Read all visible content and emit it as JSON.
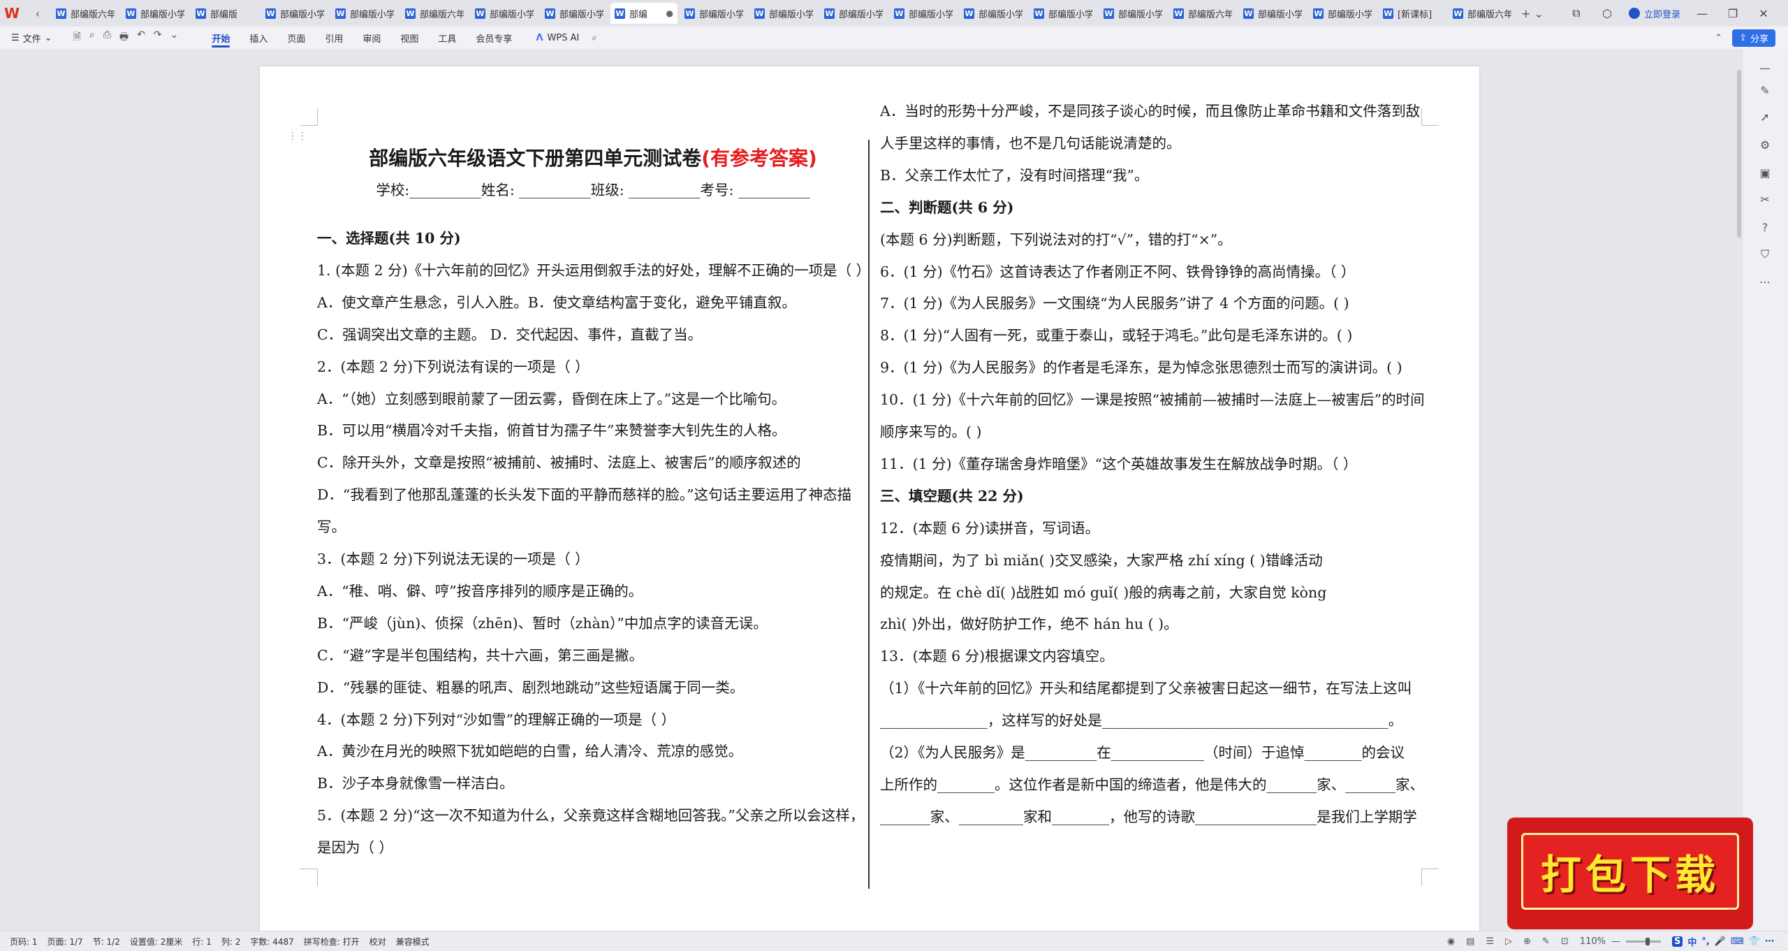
{
  "tabbar": {
    "logo": "W",
    "nav": "‹",
    "tabs": [
      {
        "label": "部编版六年",
        "active": false
      },
      {
        "label": "部编版小学",
        "active": false
      },
      {
        "label": "部编版",
        "active": false
      },
      {
        "label": "部编版小学",
        "active": false
      },
      {
        "label": "部编版小学",
        "active": false
      },
      {
        "label": "部编版六年",
        "active": false
      },
      {
        "label": "部编版小学",
        "active": false
      },
      {
        "label": "部编版小学",
        "active": false
      },
      {
        "label": "部编",
        "active": true
      },
      {
        "label": "部编版小学",
        "active": false
      },
      {
        "label": "部编版小学",
        "active": false
      },
      {
        "label": "部编版小学",
        "active": false
      },
      {
        "label": "部编版小学",
        "active": false
      },
      {
        "label": "部编版小学",
        "active": false
      },
      {
        "label": "部编版小学",
        "active": false
      },
      {
        "label": "部编版小学",
        "active": false
      },
      {
        "label": "部编版六年",
        "active": false
      },
      {
        "label": "部编版小学",
        "active": false
      },
      {
        "label": "部编版小学",
        "active": false
      },
      {
        "label": "[新课标]",
        "active": false
      },
      {
        "label": "部编版六年",
        "active": false
      }
    ],
    "login": "立即登录"
  },
  "ribbon": {
    "file": "文件",
    "tabs": [
      "开始",
      "插入",
      "页面",
      "引用",
      "审阅",
      "视图",
      "工具",
      "会员专享"
    ],
    "active_tab": "开始",
    "ai": "WPS AI",
    "share": "分享"
  },
  "doc": {
    "title_main": "部编版六年级语文下册第四单元测试卷",
    "title_red": "(有参考答案)",
    "info": "学校:__________姓名: __________班级: __________考号: __________",
    "left_lines": [
      {
        "text": "一、选择题(共 10 分)",
        "bold": true
      },
      {
        "text": "1. (本题 2 分)《十六年前的回忆》开头运用倒叙手法的好处，理解不正确的一项是（    ）"
      },
      {
        "text": "A．使文章产生悬念，引人入胜。B．使文章结构富于变化，避免平铺直叙。"
      },
      {
        "text": "C．强调突出文章的主题。           D．交代起因、事件，直截了当。"
      },
      {
        "text": "2．(本题 2 分)下列说法有误的一项是（    ）"
      },
      {
        "text": "A．“（她）立刻感到眼前蒙了一团云雾，昏倒在床上了。”这是一个比喻句。"
      },
      {
        "text": "B．可以用“横眉冷对千夫指，俯首甘为孺子牛”来赞誉李大钊先生的人格。"
      },
      {
        "text": "C．除开头外，文章是按照“被捕前、被捕时、法庭上、被害后”的顺序叙述的"
      },
      {
        "text": "D．“我看到了他那乱蓬蓬的长头发下面的平静而慈祥的脸。”这句话主要运用了神态描"
      },
      {
        "text": "写。"
      },
      {
        "text": "3．(本题 2 分)下列说法无误的一项是（    ）"
      },
      {
        "text": "A．“稚、哨、僻、哼”按音序排列的顺序是正确的。"
      },
      {
        "text": "B．“严峻（jùn)、侦探（zhēn)、暂时（zhàn）”中加点字的读音无误。"
      },
      {
        "text": "C．“避”字是半包围结构，共十六画，第三画是撇。"
      },
      {
        "text": "D．“残暴的匪徒、粗暴的吼声、剧烈地跳动”这些短语属于同一类。"
      },
      {
        "text": "4．(本题 2 分)下列对“沙如雪”的理解正确的一项是（   ）"
      },
      {
        "text": "A．黄沙在月光的映照下犹如皑皑的白雪，给人清冷、荒凉的感觉。"
      },
      {
        "text": "B．沙子本身就像雪一样洁白。"
      },
      {
        "text": "5．(本题 2 分)“这一次不知道为什么，父亲竟这样含糊地回答我。”父亲之所以会这样，"
      },
      {
        "text": "是因为（      ）"
      }
    ],
    "right_lines": [
      {
        "text": "A．当时的形势十分严峻，不是同孩子谈心的时候，而且像防止革命书籍和文件落到敌"
      },
      {
        "text": "人手里这样的事情，也不是几句话能说清楚的。"
      },
      {
        "text": "B．父亲工作太忙了，没有时间搭理“我”。"
      },
      {
        "text": "二、判断题(共 6 分)",
        "bold": true
      },
      {
        "text": "(本题 6 分)判断题，下列说法对的打“√”，错的打“×”。"
      },
      {
        "text": "6．(1 分)《竹石》这首诗表达了作者刚正不阿、铁骨铮铮的高尚情操。（     ）"
      },
      {
        "text": "7．(1 分)《为人民服务》一文围绕“为人民服务”讲了 4 个方面的问题。(      )"
      },
      {
        "text": "8．(1 分)“人固有一死，或重于泰山，或轻于鸿毛。”此句是毛泽东讲的。(      )"
      },
      {
        "text": "9．(1 分)《为人民服务》的作者是毛泽东，是为悼念张思德烈士而写的演讲词。(     )"
      },
      {
        "text": "10．(1 分)《十六年前的回忆》一课是按照“被捕前—被捕时—法庭上—被害后”的时间"
      },
      {
        "text": "顺序来写的。(        )"
      },
      {
        "text": "11．(1 分)《董存瑞舍身炸暗堡》“这个英雄故事发生在解放战争时期。（      ）"
      },
      {
        "text": "三、填空题(共 22 分)",
        "bold": true
      },
      {
        "text": "12．(本题 6 分)读拼音，写词语。"
      },
      {
        "text": "疫情期间，为了 bì miǎn(           )交叉感染，大家严格 zhí xíng (                 )错峰活动"
      },
      {
        "text": "的规定。在 chè dǐ(          )战胜如 mó guǐ(           )般的病毒之前，大家自觉 kòng"
      },
      {
        "text": "zhì(          )外出，做好防护工作，绝不 hán hu (               )。"
      },
      {
        "text": "13．(本题 6 分)根据课文内容填空。"
      },
      {
        "text": "（1）《十六年前的回忆》开头和结尾都提到了父亲被害日起这一细节，在写法上这叫"
      },
      {
        "text": "_______________，这样写的好处是________________________________________。"
      },
      {
        "text": "（2）《为人民服务》是__________在_____________（时间）于追悼________的会议"
      },
      {
        "text": "上所作的________。这位作者是新中国的缔造者，他是伟大的_______家、_______家、"
      },
      {
        "text": "_______家、_________家和________，他写的诗歌_________________是我们上学期学"
      }
    ]
  },
  "statusbar": {
    "items": [
      "页码: 1",
      "页面: 1/7",
      "节: 1/2",
      "设置值: 2厘米",
      "行: 1",
      "列: 2",
      "字数: 4487",
      "拼写检查: 打开",
      "校对",
      "兼容模式"
    ],
    "zoom": "110%",
    "ime": [
      "S",
      "中",
      "°,",
      "🎤",
      "⌨",
      "👕",
      "⋯"
    ]
  },
  "banner": {
    "text": "打包下载"
  }
}
